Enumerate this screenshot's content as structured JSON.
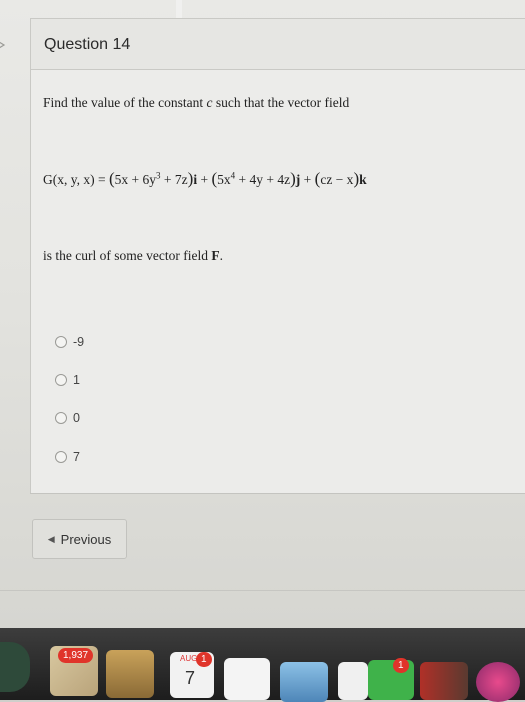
{
  "question": {
    "title": "Question 14",
    "prompt_before": "Find the value of the constant ",
    "constant": "c",
    "prompt_after": " such that the vector field",
    "equation": {
      "lhs": "G(x, y, x) = ",
      "i_part": "5x + 6y",
      "i_exp": "3",
      "i_rest": " + 7z",
      "i_unit": "i",
      "j_part": "5x",
      "j_exp": "4",
      "j_rest": " + 4y + 4z",
      "j_unit": "j",
      "k_part": "cz − x",
      "k_unit": "k"
    },
    "after_text": "is the curl of some vector field ",
    "field_name": "F",
    "period": "."
  },
  "options": [
    {
      "label": "-9"
    },
    {
      "label": "1"
    },
    {
      "label": "0"
    },
    {
      "label": "7"
    }
  ],
  "nav": {
    "previous_label": "Previous"
  },
  "dock": {
    "mail_badge": "1,937",
    "calendar_month": "AUG",
    "calendar_day": "7",
    "calendar_badge": "1",
    "messages_badge": "1"
  },
  "colors": {
    "badge": "#e0342a",
    "facetime_green": "#3fb24a"
  }
}
